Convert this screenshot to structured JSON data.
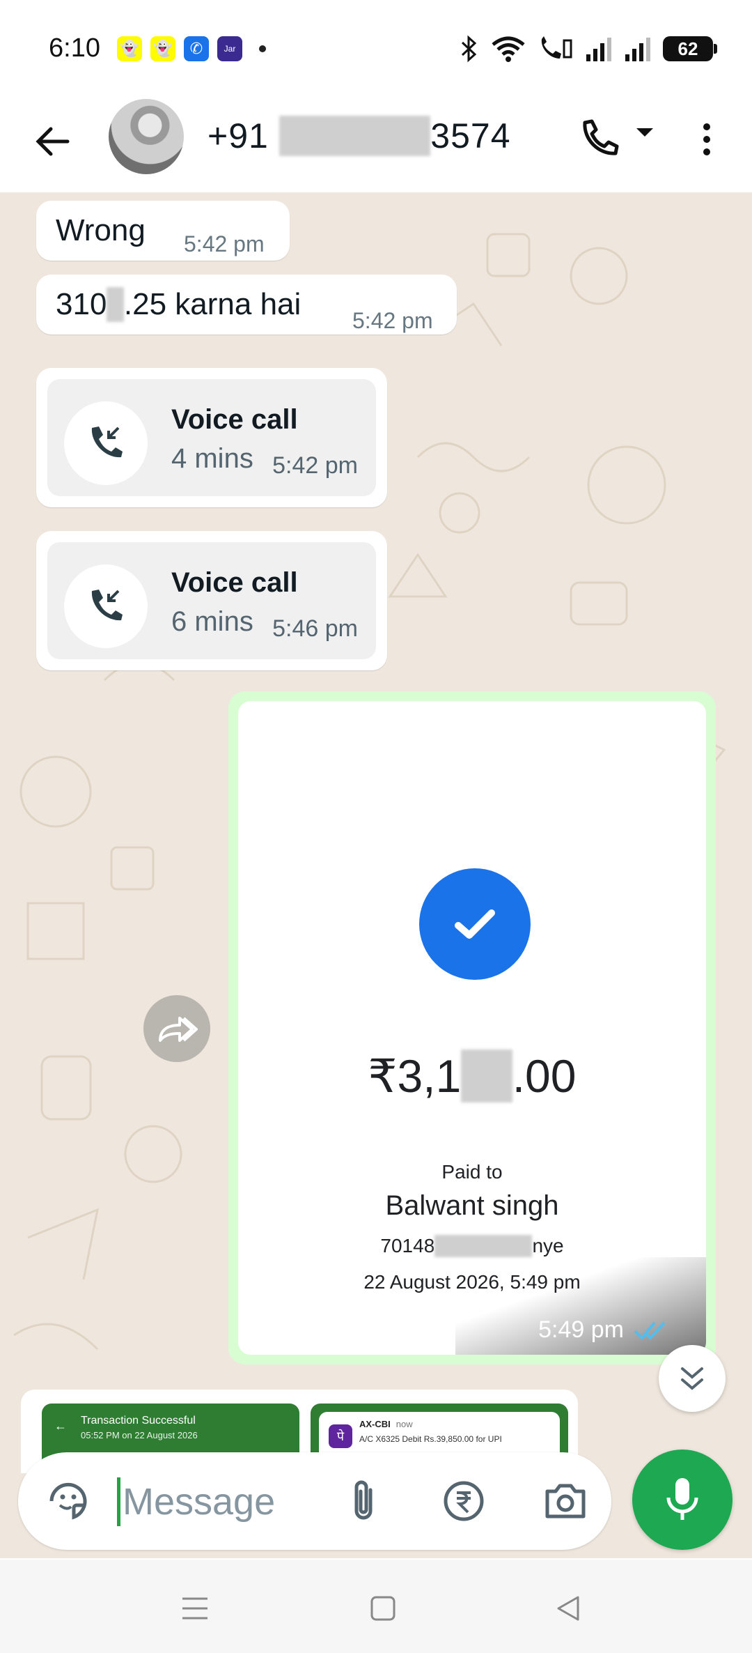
{
  "status_bar": {
    "time": "6:10",
    "battery": "62",
    "notification_icons": [
      "snapchat-icon",
      "snapchat-icon",
      "chat-icon",
      "phone-app-icon",
      "jar-icon"
    ]
  },
  "header": {
    "contact_prefix": "+91",
    "contact_suffix": "3574"
  },
  "messages": [
    {
      "text": "Wrong",
      "time": "5:42 pm"
    },
    {
      "text_start": "310",
      "text_end": ".25 karna hai",
      "time": "5:42 pm"
    }
  ],
  "calls": [
    {
      "title": "Voice call",
      "duration": "4 mins",
      "time": "5:42 pm"
    },
    {
      "title": "Voice call",
      "duration": "6 mins",
      "time": "5:46 pm"
    }
  ],
  "payment": {
    "amount_start": "₹3,1",
    "amount_end": ".00",
    "paid_to_label": "Paid to",
    "payee": "Balwant singh",
    "upi_start": "70148",
    "upi_end": "nye",
    "date": "22 August 2026, 5:49 pm",
    "time": "5:49 pm"
  },
  "previews": {
    "first_title": "Transaction Successful",
    "first_sub": "05:52 PM on 22 August 2026",
    "second_title": "AX-CBI",
    "second_now": "now",
    "second_sub": "A/C X6325 Debit Rs.39,850.00 for UPI"
  },
  "composer": {
    "placeholder": "Message"
  },
  "colors": {
    "accent_green": "#1da851",
    "chat_background": "#efe7dd",
    "outgoing_bubble": "#d9fdd3",
    "check_blue": "#1a73e8",
    "read_ticks": "#53bdeb"
  }
}
